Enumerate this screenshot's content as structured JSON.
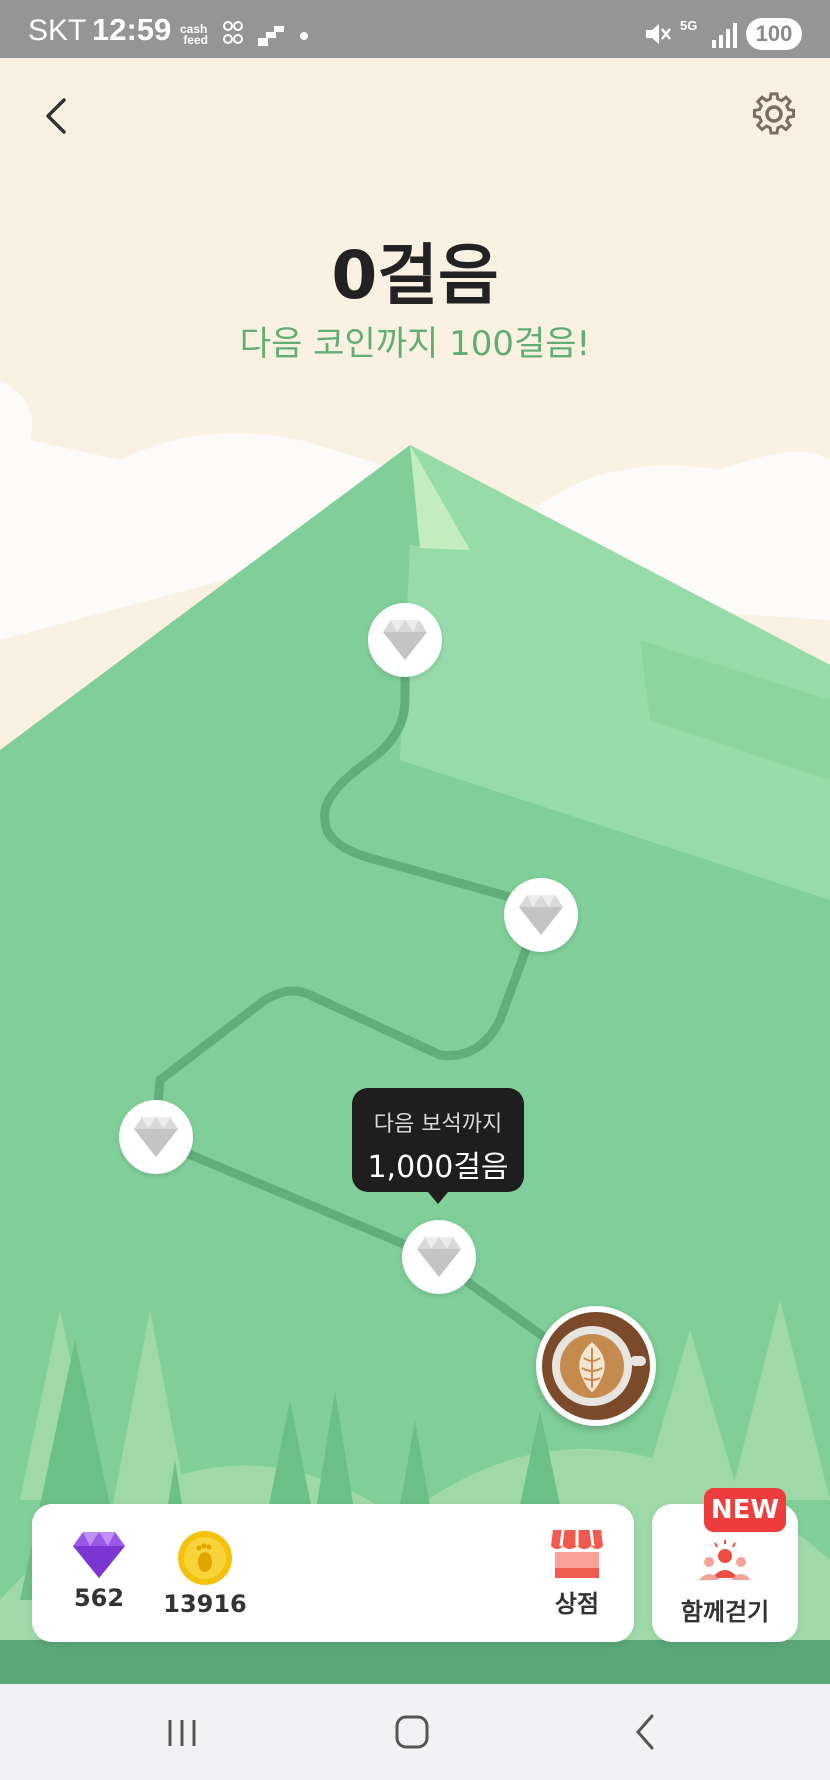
{
  "status_bar": {
    "carrier": "SKT",
    "time": "12:59",
    "feed_label": "cash feed",
    "battery": "100",
    "network": "5G"
  },
  "header": {
    "back_icon": "chevron-left-icon",
    "settings_icon": "gear-icon"
  },
  "main": {
    "steps_title": "0걸음",
    "steps_subtitle": "다음 코인까지 100걸음!"
  },
  "tooltip": {
    "line1": "다음 보석까지",
    "line2": "1,000걸음"
  },
  "bottom_bar": {
    "gems_count": "562",
    "coins_count": "13916",
    "shop_label": "상점",
    "walk_together_label": "함께걷기",
    "new_badge": "NEW"
  },
  "colors": {
    "background": "#fbf1e2",
    "mountain": "#80cf9a",
    "path": "#5fae7b",
    "subtitle": "#5fae75",
    "badge": "#ef3d3d",
    "gem_purple": "#a15ee8",
    "coin": "#f4c20d"
  }
}
